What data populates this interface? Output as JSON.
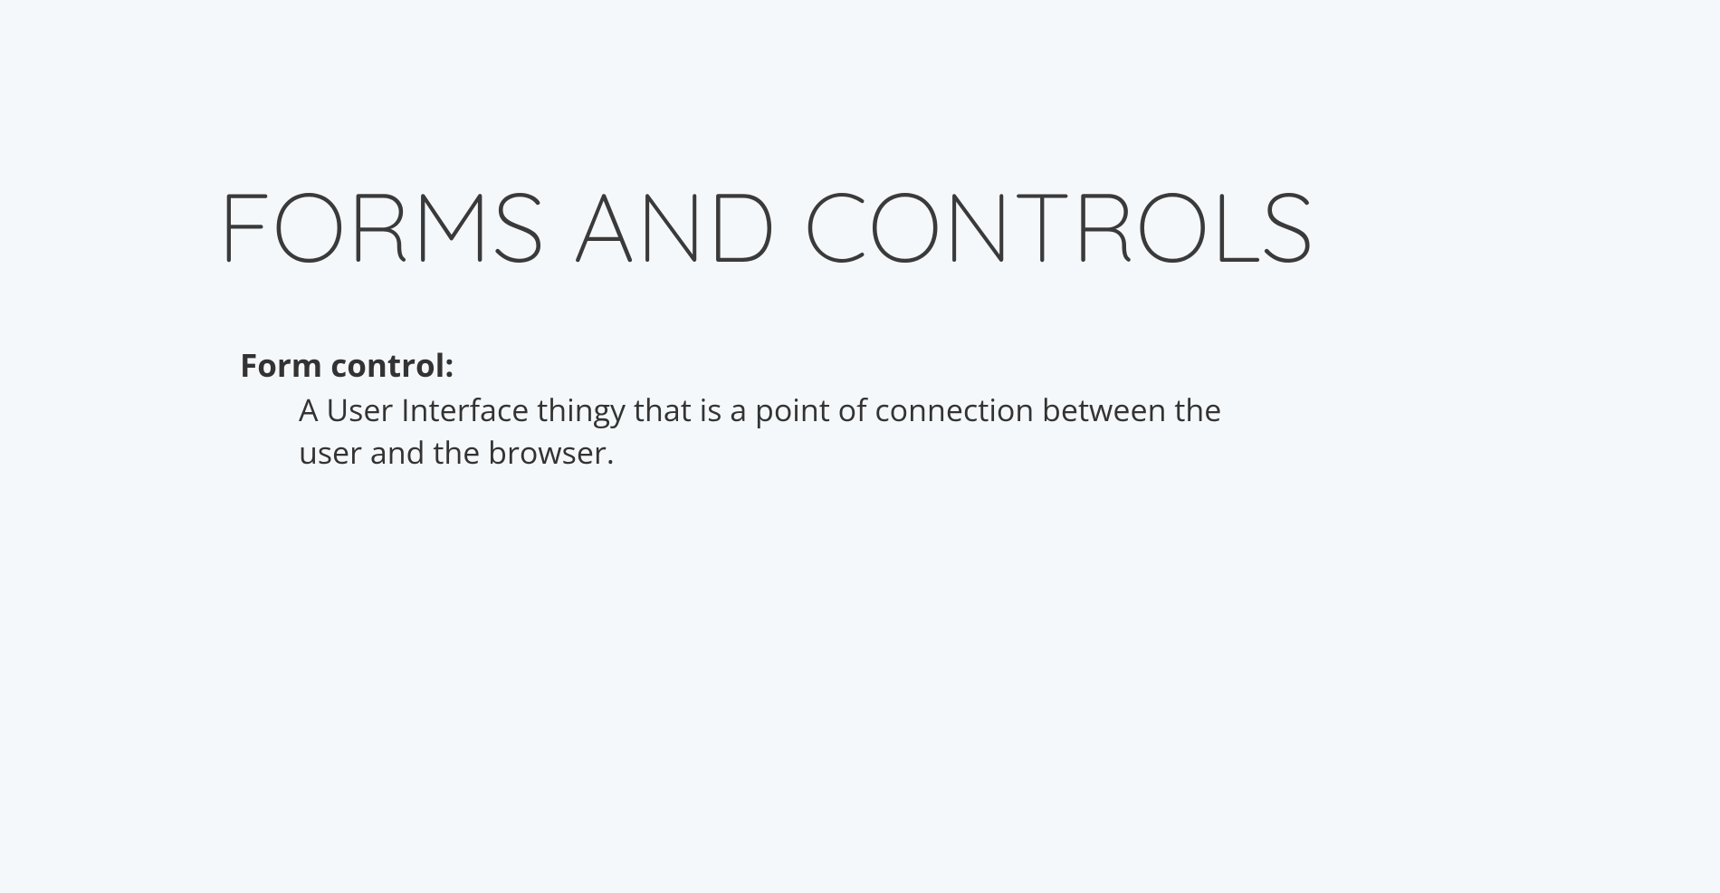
{
  "slide": {
    "title": "FORMS AND CONTROLS",
    "definition": {
      "term": "Form control:",
      "text": "A User Interface thingy that is a point of connection between the user and the browser."
    }
  }
}
